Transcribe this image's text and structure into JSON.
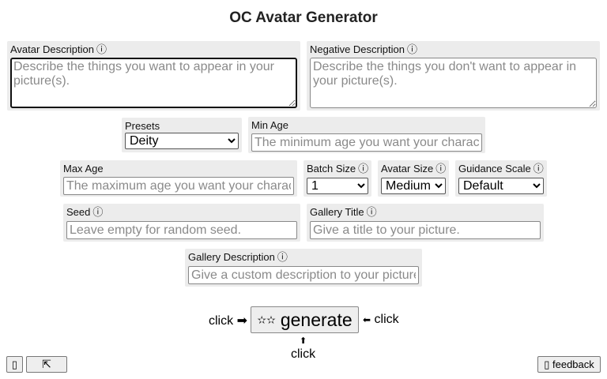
{
  "title": "OC Avatar Generator",
  "avatar_description": {
    "label": "Avatar Description",
    "info_icon": "ⓘ",
    "placeholder": "Describe the things you want to appear in your picture(s)."
  },
  "negative_description": {
    "label": "Negative Description",
    "info_icon": "ⓘ",
    "placeholder": "Describe the things you don't want to appear in your picture(s)."
  },
  "presets": {
    "label": "Presets",
    "selected": "Deity"
  },
  "min_age": {
    "label": "Min Age",
    "placeholder": "The minimum age you want your character to be."
  },
  "max_age": {
    "label": "Max Age",
    "placeholder": "The maximum age you want your character to be."
  },
  "batch_size": {
    "label": "Batch Size",
    "info_icon": "ⓘ",
    "selected": "1"
  },
  "avatar_size": {
    "label": "Avatar Size",
    "info_icon": "ⓘ",
    "selected": "Medium"
  },
  "guidance_scale": {
    "label": "Guidance Scale",
    "info_icon": "ⓘ",
    "selected": "Default"
  },
  "seed": {
    "label": "Seed",
    "info_icon": "ⓘ",
    "placeholder": "Leave empty for random seed."
  },
  "gallery_title": {
    "label": "Gallery Title",
    "info_icon": "ⓘ",
    "placeholder": "Give a title to your picture."
  },
  "gallery_description": {
    "label": "Gallery Description",
    "info_icon": "ⓘ",
    "placeholder": "Give a custom description to your picture."
  },
  "generate": {
    "stars_icon": "✫✫",
    "label": "generate",
    "hint_left": "click",
    "arrow_right": "➡",
    "hint_right": "click",
    "arrow_left": "⬅",
    "hint_bottom": "click",
    "arrow_up": "⬆"
  },
  "footer": {
    "left_button_icon": "▯",
    "expand_icon": "⇱",
    "feedback_icon": "▯",
    "feedback_label": "feedback"
  }
}
